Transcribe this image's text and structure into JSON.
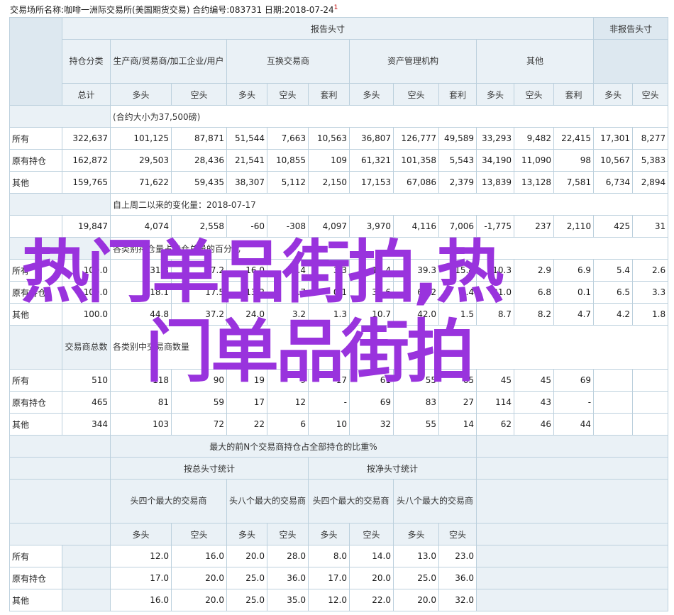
{
  "header": {
    "text": "交易场所名称:咖啡一洲际交易所(美国期货交易)  合约编号:083731  日期:2018-07-24",
    "mark": "1"
  },
  "watermark": {
    "line1": "热门单品街拍,热",
    "line2": "门单品街拍"
  },
  "s1": {
    "report_head": "报告头寸",
    "nonreport_head": "非报告头寸",
    "category": "持仓分类",
    "producer": "生产商/贸易商/加工企业/用户",
    "swap": "互换交易商",
    "asset": "资产管理机构",
    "other": "其他",
    "total": "总计",
    "long": "多头",
    "short": "空头",
    "spread": "套利",
    "note": "(合约大小为37,500磅)",
    "rows": [
      {
        "label": "所有",
        "v": [
          "322,637",
          "101,125",
          "87,871",
          "51,544",
          "7,663",
          "10,563",
          "36,807",
          "126,777",
          "49,589",
          "33,293",
          "9,482",
          "22,415",
          "17,301",
          "8,277"
        ]
      },
      {
        "label": "原有持仓",
        "v": [
          "162,872",
          "29,503",
          "28,436",
          "21,541",
          "10,855",
          "109",
          "61,321",
          "101,358",
          "5,543",
          "34,190",
          "11,090",
          "98",
          "10,567",
          "5,383"
        ]
      },
      {
        "label": "其他",
        "v": [
          "159,765",
          "71,622",
          "59,435",
          "38,307",
          "5,112",
          "2,150",
          "17,153",
          "67,086",
          "2,379",
          "13,839",
          "13,128",
          "7,581",
          "6,734",
          "2,894"
        ]
      }
    ]
  },
  "s2": {
    "note": "自上周二以来的变化量：2018-07-17",
    "v": [
      "19,847",
      "4,074",
      "2,558",
      "-60",
      "-308",
      "4,097",
      "3,970",
      "4,116",
      "7,006",
      "-1,775",
      "237",
      "2,110",
      "425",
      "31"
    ]
  },
  "s3": {
    "note": "各类别持仓量占持仓总量的百分比",
    "rows": [
      {
        "label": "所有",
        "v": [
          "100.0",
          "31.3",
          "27.2",
          "16.0",
          "2.4",
          "3.3",
          "11.4",
          "39.3",
          "15.4",
          "10.3",
          "2.9",
          "6.9",
          "5.4",
          "2.6"
        ]
      },
      {
        "label": "原有持仓",
        "v": [
          "100.0",
          "18.1",
          "17.5",
          "13.2",
          "6.7",
          "0.1",
          "37.6",
          "62.2",
          "3.4",
          "21.0",
          "6.8",
          "0.1",
          "6.5",
          "3.3"
        ]
      },
      {
        "label": "其他",
        "v": [
          "100.0",
          "44.8",
          "37.2",
          "24.0",
          "3.2",
          "1.3",
          "10.7",
          "42.0",
          "1.5",
          "8.7",
          "8.2",
          "4.7",
          "4.2",
          "1.8"
        ]
      }
    ]
  },
  "s4": {
    "head": "交易商总数",
    "note": "各类别中交易商数量",
    "rows": [
      {
        "label": "所有",
        "v": [
          "510",
          "118",
          "90",
          "19",
          "9",
          "17",
          "61",
          "55",
          "65",
          "45",
          "45",
          "69",
          "",
          ""
        ]
      },
      {
        "label": "原有持仓",
        "v": [
          "465",
          "81",
          "59",
          "17",
          "12",
          "-",
          "69",
          "83",
          "27",
          "114",
          "43",
          "-",
          "",
          ""
        ]
      },
      {
        "label": "其他",
        "v": [
          "344",
          "103",
          "72",
          "22",
          "6",
          "10",
          "32",
          "55",
          "14",
          "62",
          "46",
          "44",
          "",
          ""
        ]
      }
    ]
  },
  "s5": {
    "title": "最大的前N个交易商持仓占全部持仓的比重%",
    "gross": "按总头寸统计",
    "net": "按净头寸统计",
    "top4": "头四个最大的交易商",
    "top8": "头八个最大的交易商",
    "long": "多头",
    "short": "空头",
    "rows": [
      {
        "label": "所有",
        "v": [
          "12.0",
          "16.0",
          "20.0",
          "28.0",
          "8.0",
          "14.0",
          "13.0",
          "23.0"
        ]
      },
      {
        "label": "原有持仓",
        "v": [
          "17.0",
          "20.0",
          "25.0",
          "36.0",
          "17.0",
          "20.0",
          "25.0",
          "36.0"
        ]
      },
      {
        "label": "其他",
        "v": [
          "16.0",
          "20.0",
          "25.0",
          "35.0",
          "12.0",
          "22.0",
          "20.0",
          "32.0"
        ]
      }
    ]
  }
}
